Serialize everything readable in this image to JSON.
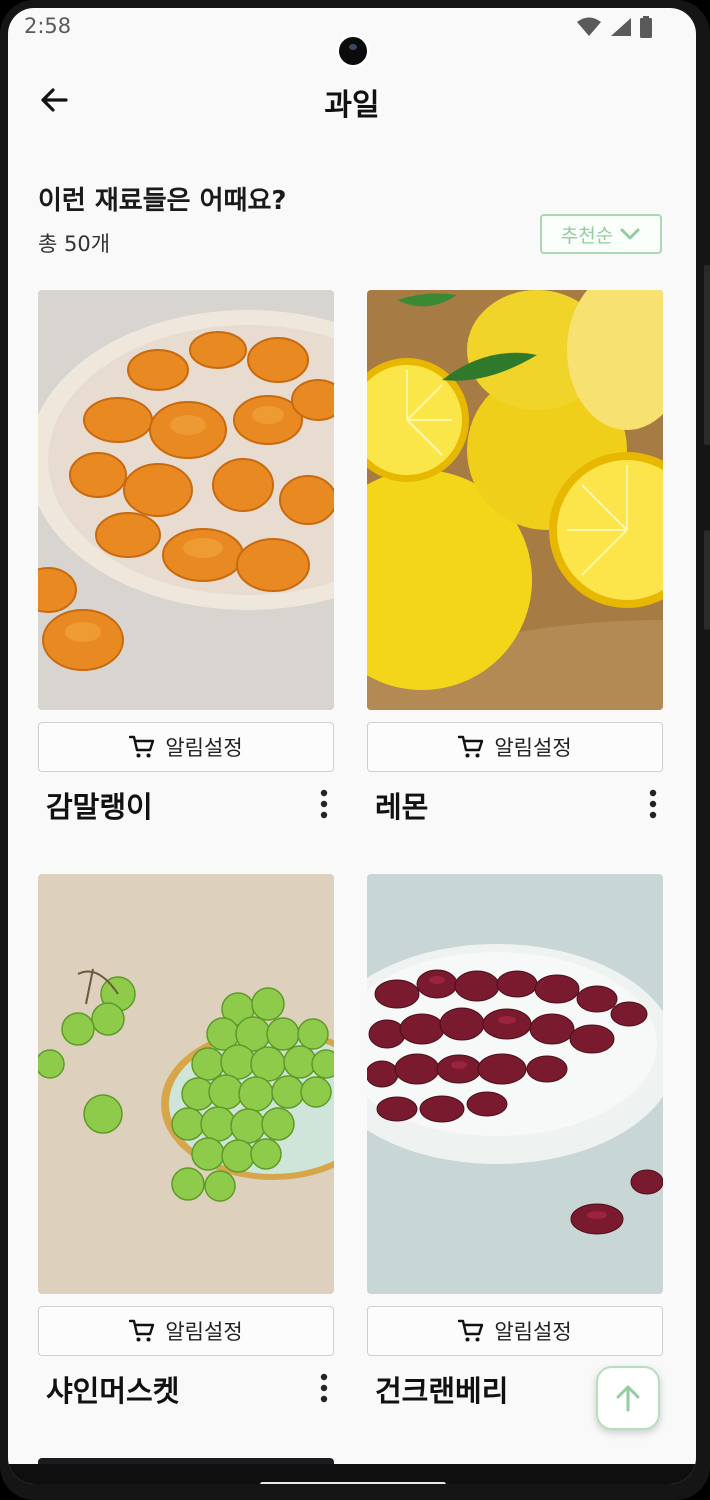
{
  "status_bar": {
    "time": "2:58",
    "icons": [
      "wifi-icon",
      "signal-icon",
      "battery-icon"
    ]
  },
  "header": {
    "title": "과일",
    "back_icon": "arrow-left-icon"
  },
  "section": {
    "heading": "이런 재료들은 어때요?",
    "count": "총 50개",
    "sort": {
      "label": "추천순",
      "icon": "chevron-down-icon"
    }
  },
  "products": [
    {
      "name": "감말랭이",
      "alert_label": "알림설정"
    },
    {
      "name": "레몬",
      "alert_label": "알림설정"
    },
    {
      "name": "샤인머스켓",
      "alert_label": "알림설정"
    },
    {
      "name": "건크랜베리",
      "alert_label": "알림설정"
    }
  ],
  "fab_icon": "arrow-up-icon",
  "colors": {
    "accent": "#94cca0",
    "accent_border": "#a9d8b1",
    "text": "#111111",
    "background": "#f9f9f9"
  }
}
